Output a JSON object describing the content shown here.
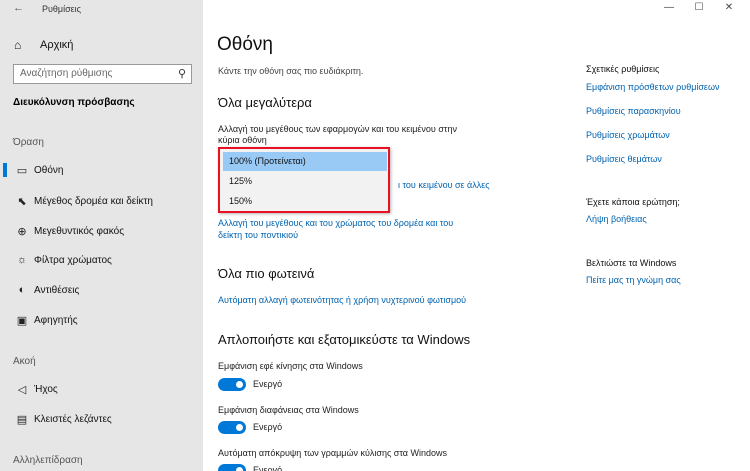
{
  "window": {
    "title": "Ρυθμίσεις",
    "back_glyph": "←",
    "minimize_glyph": "—",
    "maximize_glyph": "☐",
    "close_glyph": "✕"
  },
  "sidebar": {
    "home": "Αρχική",
    "search_placeholder": "Αναζήτηση ρύθμισης",
    "section": "Διευκόλυνση πρόσβασης",
    "groups": {
      "vision": "Όραση",
      "hearing": "Ακοή",
      "interaction": "Αλληλεπίδραση"
    },
    "vision_items": [
      "Οθόνη",
      "Μέγεθος δρομέα και δείκτη",
      "Μεγεθυντικός φακός",
      "Φίλτρα χρώματος",
      "Αντιθέσεις",
      "Αφηγητής"
    ],
    "hearing_items": [
      "Ήχος",
      "Κλειστές λεζάντες"
    ]
  },
  "main": {
    "title": "Οθόνη",
    "subtitle": "Κάντε την οθόνη σας πιο ευδιάκριτη.",
    "bigger": {
      "heading": "Όλα μεγαλύτερα",
      "scale_label_line1": "Αλλαγή του μεγέθους των εφαρμογών και του κειμένου στην",
      "scale_label_line2": "κύρια οθόνη",
      "scale_options": [
        "100% (Προτείνεται)",
        "125%",
        "150%"
      ],
      "selected_index": 0,
      "other_link": "ι του κειμένου σε άλλες",
      "pointer_link_line1": "Αλλαγή του μεγέθους και του χρώματος του δρομέα και του",
      "pointer_link_line2": "δείκτη του ποντικιού"
    },
    "brighter": {
      "heading": "Όλα πιο φωτεινά",
      "link": "Αυτόματη αλλαγή φωτεινότητας ή χρήση νυχτερινού φωτισμού"
    },
    "simplify": {
      "heading": "Απλοποιήστε και εξατομικεύστε τα Windows",
      "toggles": [
        {
          "label": "Εμφάνιση εφέ κίνησης στα Windows",
          "state": "Ενεργό"
        },
        {
          "label": "Εμφάνιση διαφάνειας στα Windows",
          "state": "Ενεργό"
        },
        {
          "label": "Αυτόματη απόκρυψη των γραμμών κύλισης στα Windows",
          "state": "Ενεργό"
        }
      ]
    }
  },
  "right": {
    "related": {
      "heading": "Σχετικές ρυθμίσεις",
      "links": [
        "Εμφάνιση πρόσθετων ρυθμίσεων",
        "Ρυθμίσεις παρασκηνίου",
        "Ρυθμίσεις χρωμάτων",
        "Ρυθμίσεις θεμάτων"
      ]
    },
    "question": {
      "heading": "Έχετε κάποια ερώτηση;",
      "link": "Λήψη βοήθειας"
    },
    "feedback": {
      "heading": "Βελτιώστε τα Windows",
      "link": "Πείτε μας τη γνώμη σας"
    }
  },
  "colors": {
    "accent": "#0078d7",
    "link": "#0063b1",
    "highlight_border": "#e81123"
  }
}
